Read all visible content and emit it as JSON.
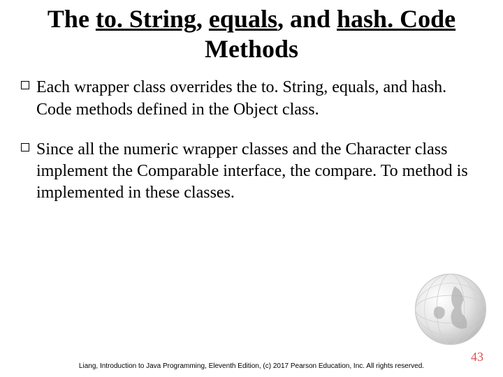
{
  "title": {
    "pre": "The ",
    "u1": "to. String",
    "sep1": ", ",
    "u2": "equals",
    "sep2": ", and ",
    "u3": "hash. Code",
    "post": " Methods"
  },
  "bullets": [
    "Each wrapper class overrides the to. String, equals, and hash. Code methods defined in the Object class.",
    "Since all the numeric wrapper classes and the Character class implement the Comparable interface, the compare. To method is implemented in these classes."
  ],
  "footer": "Liang, Introduction to Java Programming, Eleventh Edition, (c) 2017 Pearson Education, Inc. All rights reserved.",
  "page_number": "43"
}
